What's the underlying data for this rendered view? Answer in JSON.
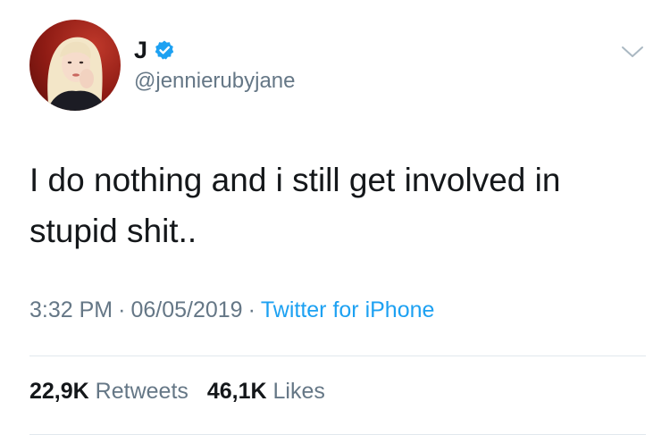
{
  "author": {
    "display_name": "J",
    "handle": "@jennierubyjane",
    "verified": true,
    "avatar_icon": "profile-photo"
  },
  "tweet": {
    "text_line1": "I do nothing and i still get involved in",
    "text_line2": "stupid shit.."
  },
  "meta": {
    "time": "3:32 PM",
    "date": "06/05/2019",
    "separator": "·",
    "source": "Twitter for iPhone"
  },
  "stats": {
    "retweets_count": "22,9K",
    "retweets_label": "Retweets",
    "likes_count": "46,1K",
    "likes_label": "Likes"
  },
  "colors": {
    "text": "#14171a",
    "secondary": "#657786",
    "link": "#1da1f2",
    "divider": "#e1e8ed",
    "verified_badge": "#1da1f2"
  }
}
